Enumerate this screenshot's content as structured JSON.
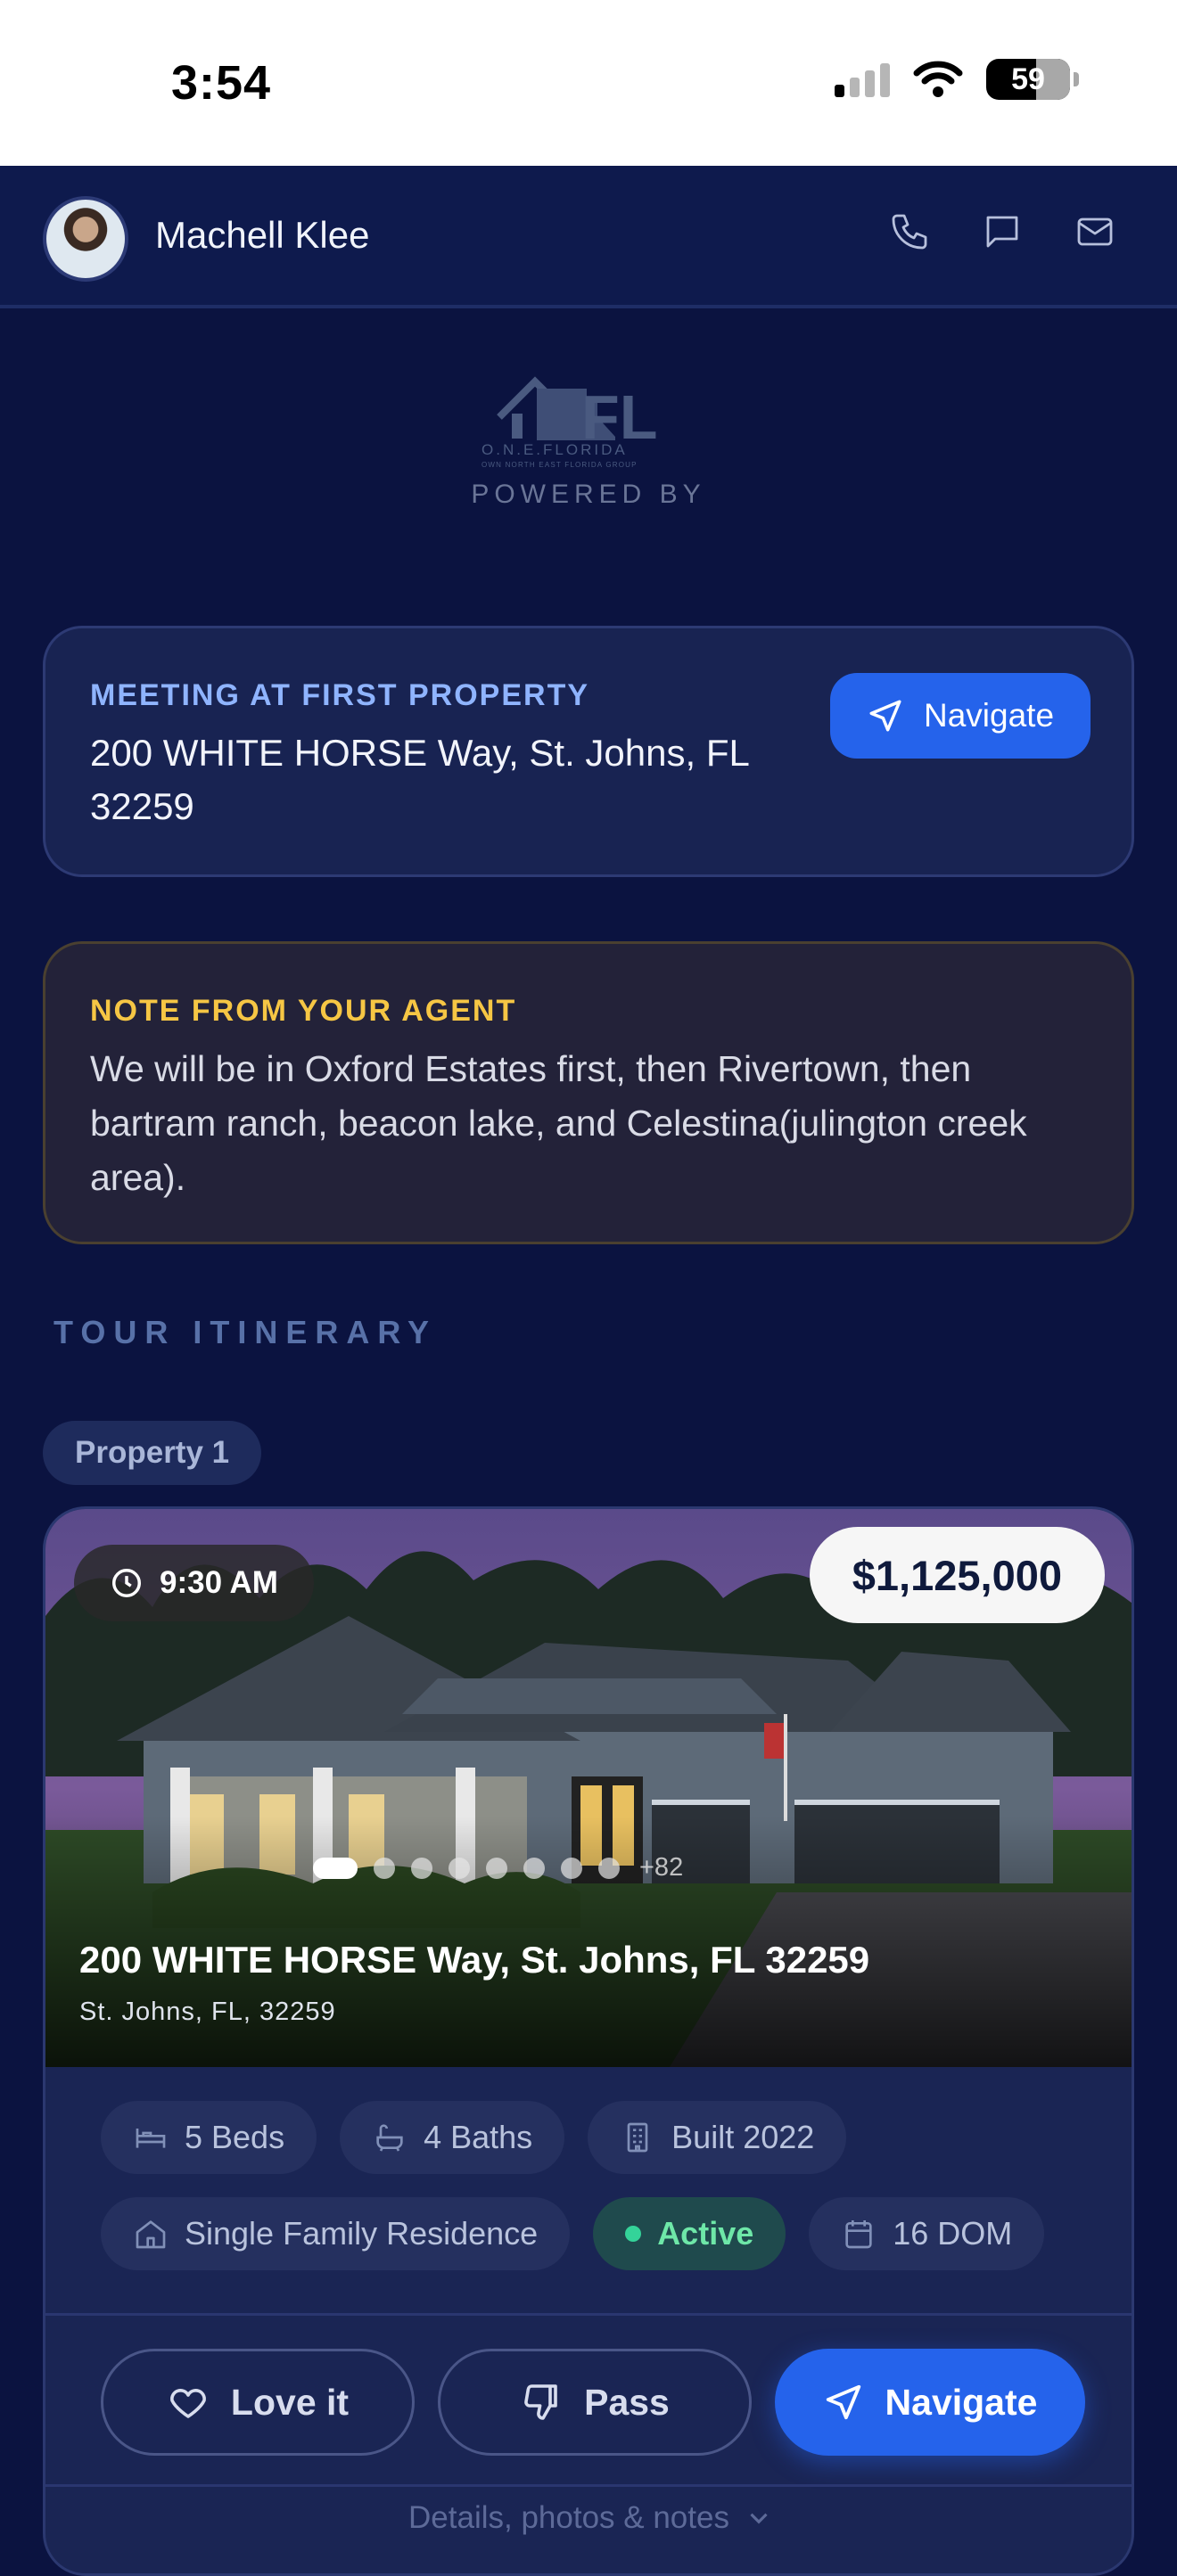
{
  "status_bar": {
    "time": "3:54",
    "battery": "59"
  },
  "header": {
    "agent_name": "Machell Klee"
  },
  "logo": {
    "main": "FL",
    "name": "O.N.E.FLORIDA",
    "tagline": "OWN NORTH EAST FLORIDA GROUP"
  },
  "powered_by": "POWERED BY",
  "meeting": {
    "label": "MEETING AT FIRST PROPERTY",
    "address": "200 WHITE HORSE Way, St. Johns, FL 32259",
    "navigate_label": "Navigate"
  },
  "note": {
    "label": "NOTE FROM YOUR AGENT",
    "text": "We will be in Oxford Estates first, then Rivertown, then bartram ranch, beacon lake, and Celestina(julington creek area)."
  },
  "itinerary_title": "TOUR ITINERARY",
  "property": {
    "label": "Property 1",
    "time": "9:30 AM",
    "price": "$1,125,000",
    "photo_more": "+82",
    "address": "200 WHITE HORSE Way, St. Johns, FL 32259",
    "city": "St. Johns, FL, 32259",
    "chips": {
      "beds": "5 Beds",
      "baths": "4 Baths",
      "built": "Built 2022",
      "type": "Single Family Residence",
      "status": "Active",
      "dom": "16 DOM"
    },
    "actions": {
      "love": "Love it",
      "pass": "Pass",
      "navigate": "Navigate"
    },
    "details_link": "Details, photos & notes"
  },
  "colors": {
    "background": "#0b1340",
    "accent": "#2563eb",
    "note_label": "#f6c644",
    "active_status": "#34d399"
  }
}
